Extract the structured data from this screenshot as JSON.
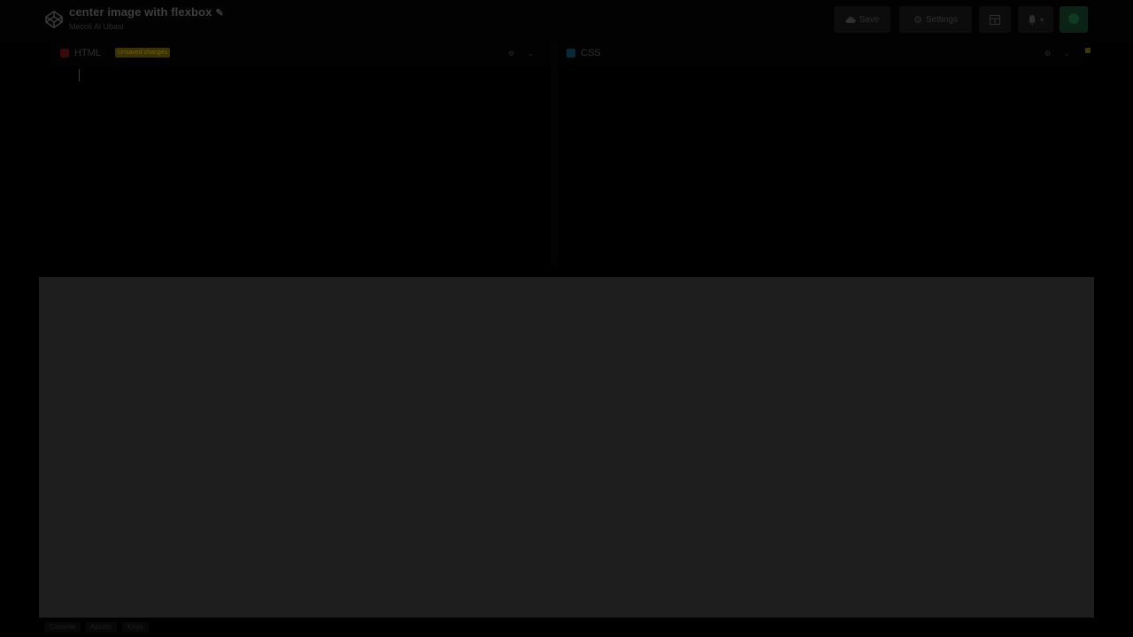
{
  "header": {
    "title": "center image with flexbox",
    "edit_icon": "pencil-icon",
    "author": "Mecoli Al Ubasi",
    "save_label": "Save",
    "settings_label": "Settings",
    "layout_icon": "layout-icon",
    "notifications_icon": "bell-icon",
    "logo_icon": "codepen-logo-icon"
  },
  "editors": [
    {
      "label": "HTML",
      "badge": "Unsaved changes",
      "color": "#3a0a0a"
    },
    {
      "label": "CSS",
      "color": "#062a3a"
    }
  ],
  "colors": {
    "preview_bg": "#1e1e1e",
    "overlay": "#000000"
  },
  "footer": {
    "console": "Console",
    "assets": "Assets",
    "keys": "Keys"
  }
}
